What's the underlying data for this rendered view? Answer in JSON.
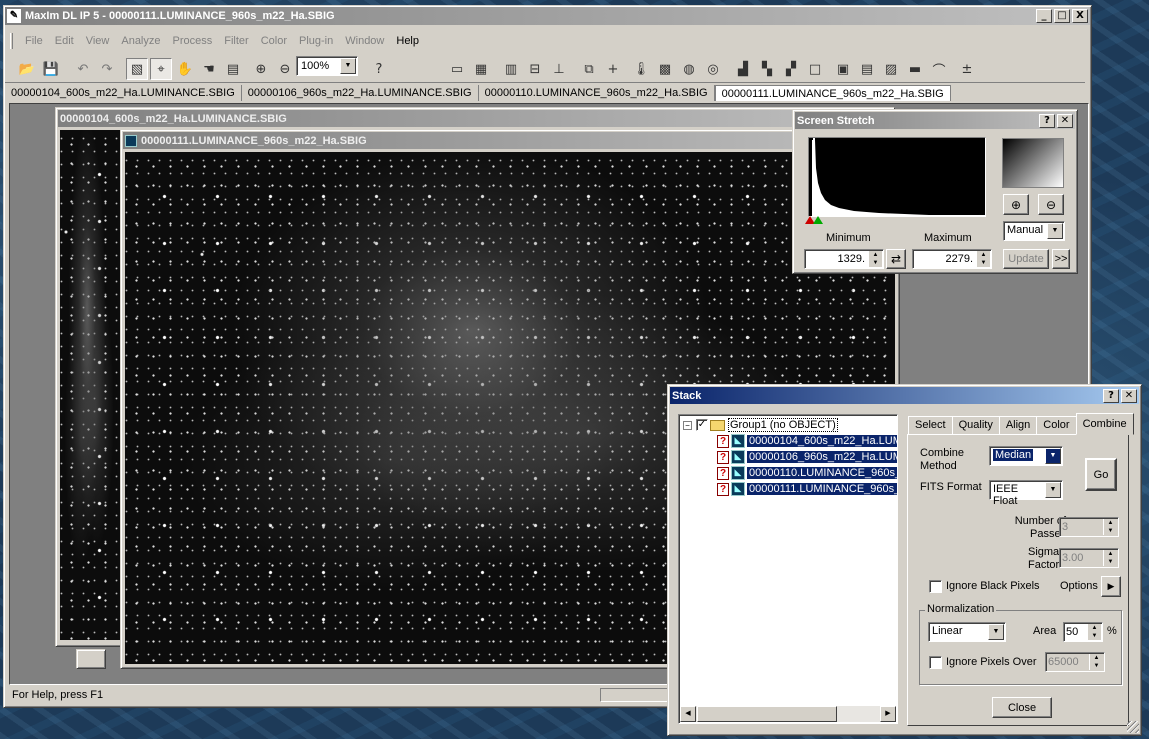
{
  "main_window": {
    "title": "MaxIm DL IP 5 - 00000111.LUMINANCE_960s_m22_Ha.SBIG",
    "buttons": [
      "_",
      "□",
      "X"
    ]
  },
  "menu": [
    "File",
    "Edit",
    "View",
    "Analyze",
    "Process",
    "Filter",
    "Color",
    "Plug-in",
    "Window",
    "Help"
  ],
  "toolbar": {
    "zoom": "100%",
    "icons": [
      "open-icon",
      "save-icon",
      "undo-icon",
      "redo-icon",
      "image-icon",
      "crosshair-icon",
      "pan-icon",
      "hand-icon",
      "info-icon",
      "zoom-in-icon",
      "zoom-out-icon",
      "help-icon"
    ]
  },
  "doc_tabs": [
    "00000104_600s_m22_Ha.LUMINANCE.SBIG",
    "00000106_960s_m22_Ha.LUMINANCE.SBIG",
    "00000110.LUMINANCE_960s_m22_Ha.SBIG",
    "00000111.LUMINANCE_960s_m22_Ha.SBIG"
  ],
  "child_windows": {
    "back_title": "00000104_600s_m22_Ha.LUMINANCE.SBIG",
    "front_title": "00000111.LUMINANCE_960s_m22_Ha.SBIG"
  },
  "status": {
    "help": "For Help, press F1"
  },
  "screen_stretch": {
    "title": "Screen Stretch",
    "minimum_label": "Minimum",
    "maximum_label": "Maximum",
    "minimum_value": "1329.",
    "maximum_value": "2279.",
    "mode": "Manual",
    "update_label": "Update",
    "more_label": ">>"
  },
  "stack": {
    "title": "Stack",
    "group": "Group1 (no OBJECT)",
    "files": [
      "00000104_600s_m22_Ha.LUM",
      "00000106_960s_m22_Ha.LUM",
      "00000110.LUMINANCE_960s_",
      "00000111.LUMINANCE_960s_"
    ],
    "tabs": [
      "Select",
      "Quality",
      "Align",
      "Color",
      "Combine"
    ],
    "active_tab": "Combine",
    "combine_method_label": "Combine Method",
    "combine_method_line1": "Combine",
    "combine_method_line2": "Method",
    "combine_method": "Median",
    "fits_format_label": "FITS Format",
    "fits_format": "IEEE Float",
    "go_label": "Go",
    "passes_label_1": "Number of",
    "passes_label_2": "Passes",
    "passes_value": "3",
    "sigma_label_1": "Sigma",
    "sigma_label_2": "Factor",
    "sigma_value": "3.00",
    "ignore_black_label": "Ignore Black Pixels",
    "options_label": "Options",
    "normalization_label": "Normalization",
    "normalization": "Linear",
    "area_label": "Area",
    "area_value": "50",
    "area_unit": "%",
    "ignore_over_label": "Ignore Pixels Over",
    "ignore_over_value": "65000",
    "close_label": "Close"
  }
}
